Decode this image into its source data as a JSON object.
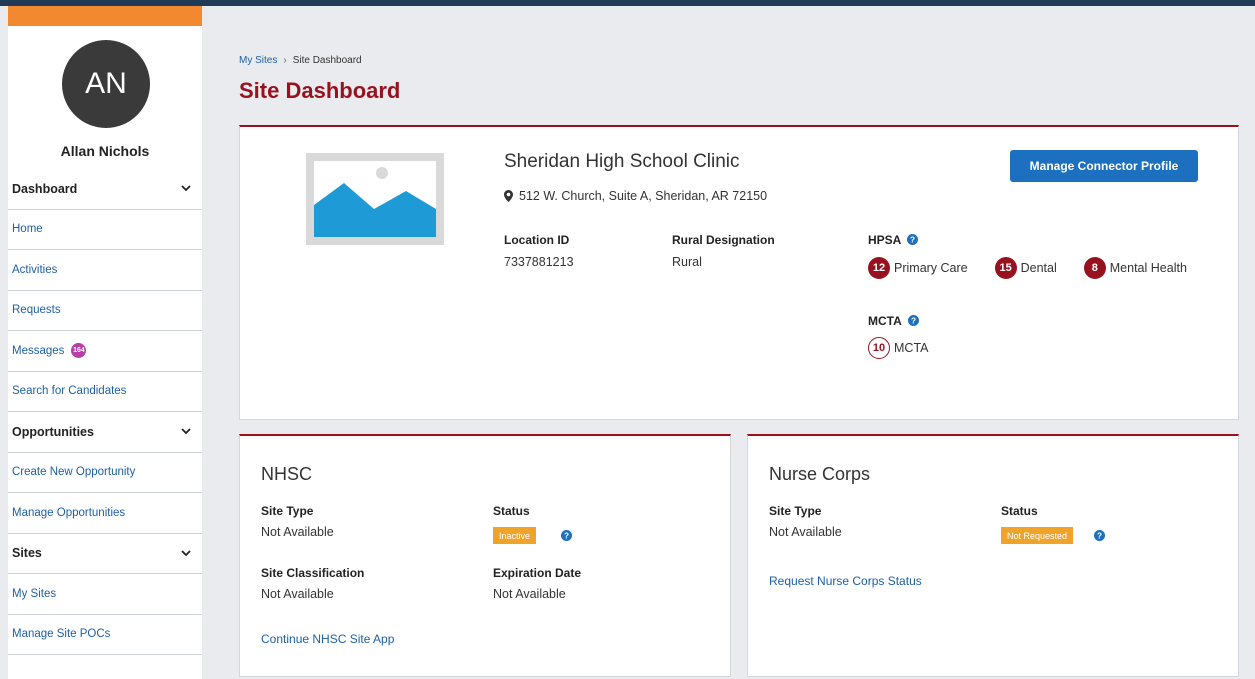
{
  "user": {
    "initials": "AN",
    "name": "Allan Nichols"
  },
  "nav": {
    "dashboard": "Dashboard",
    "home": "Home",
    "activities": "Activities",
    "requests": "Requests",
    "messages": "Messages",
    "messages_count": "164",
    "search_candidates": "Search for Candidates",
    "opportunities": "Opportunities",
    "create_opportunity": "Create New Opportunity",
    "manage_opportunities": "Manage Opportunities",
    "sites": "Sites",
    "my_sites": "My Sites",
    "manage_site_pocs": "Manage Site POCs"
  },
  "breadcrumb": {
    "parent": "My Sites",
    "separator": "›",
    "current": "Site Dashboard"
  },
  "page_title": "Site Dashboard",
  "site": {
    "name": "Sheridan High School Clinic",
    "address": "512 W. Church, Suite A, Sheridan, AR 72150",
    "manage_button": "Manage Connector Profile",
    "location_id_label": "Location ID",
    "location_id": "7337881213",
    "rural_label": "Rural Designation",
    "rural_value": "Rural",
    "hpsa_label": "HPSA",
    "hpsa": [
      {
        "score": "12",
        "label": "Primary Care"
      },
      {
        "score": "15",
        "label": "Dental"
      },
      {
        "score": "8",
        "label": "Mental Health"
      }
    ],
    "mcta_label": "MCTA",
    "mcta_score": "10",
    "mcta_text": "MCTA"
  },
  "nhsc": {
    "title": "NHSC",
    "site_type_label": "Site Type",
    "site_type": "Not Available",
    "status_label": "Status",
    "status": "Inactive",
    "classification_label": "Site Classification",
    "classification": "Not Available",
    "expiration_label": "Expiration Date",
    "expiration": "Not Available",
    "link": "Continue NHSC Site App"
  },
  "nurse": {
    "title": "Nurse Corps",
    "site_type_label": "Site Type",
    "site_type": "Not Available",
    "status_label": "Status",
    "status": "Not Requested",
    "link": "Request Nurse Corps Status"
  },
  "colors": {
    "brand_red": "#98111e",
    "link_blue": "#1d5fa6",
    "accent_orange": "#f2882f",
    "status_orange": "#f0a329"
  }
}
